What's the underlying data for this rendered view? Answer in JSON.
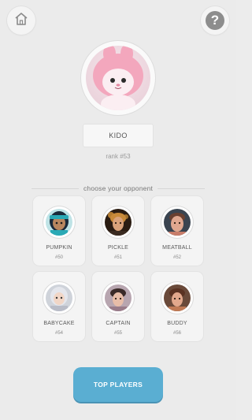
{
  "header": {
    "home_icon": "home-icon",
    "help_icon": "question-mark-icon",
    "help_glyph": "?"
  },
  "player": {
    "name": "KIDO",
    "rank": "rank #53",
    "avatar_icon": "pink-bunny-avatar"
  },
  "opponents_section": {
    "title": "choose your opponent"
  },
  "opponents": [
    {
      "name": "PUMPKIN",
      "rank": "#50",
      "avatar_color": "#2aa9b5"
    },
    {
      "name": "PICKLE",
      "rank": "#51",
      "avatar_color": "#c88a3a"
    },
    {
      "name": "MEATBALL",
      "rank": "#52",
      "avatar_color": "#c87d6a"
    },
    {
      "name": "BABYCAKE",
      "rank": "#54",
      "avatar_color": "#b9bcc7"
    },
    {
      "name": "CAPTAIN",
      "rank": "#55",
      "avatar_color": "#9a7c8a"
    },
    {
      "name": "BUDDY",
      "rank": "#56",
      "avatar_color": "#c07a55"
    }
  ],
  "footer": {
    "top_players_label": "TOP PLAYERS"
  },
  "colors": {
    "background": "#ebebeb",
    "accent_button": "#5aaed2"
  }
}
